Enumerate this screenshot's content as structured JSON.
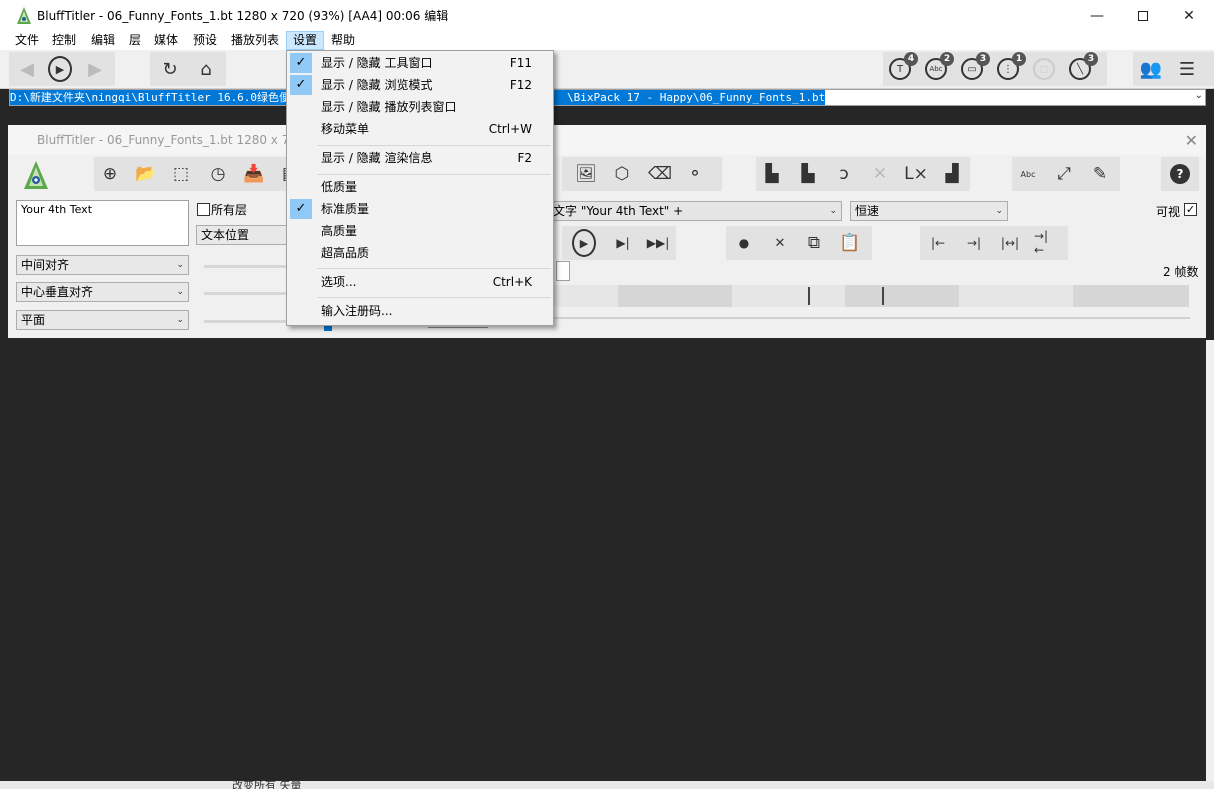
{
  "window": {
    "title": "BluffTitler - 06_Funny_Fonts_1.bt 1280 x 720 (93%) [AA4] 00:06 编辑",
    "minimize_icon": "minimize-icon",
    "maximize_icon": "maximize-icon",
    "close_icon": "close-icon"
  },
  "menubar": {
    "items": [
      "文件",
      "控制",
      "编辑",
      "层",
      "媒体",
      "预设",
      "播放列表",
      "设置",
      "帮助"
    ],
    "active": "设置"
  },
  "toolbar": {
    "badges": [
      "4",
      "2",
      "3",
      "1",
      "3"
    ],
    "abc_label": "Abc"
  },
  "path": {
    "text": "D:\\新建文件夹\\ningqi\\BluffTitler 16.6.0绿色便携版\\Media\\Shows\\BixPack 17 - Happy\\06_Funny_Fonts_1.bt",
    "visible_start": "D:\\新建文件夹\\ningqi\\BluffTitler 16.6.0绿色便携",
    "visible_end": "\\BixPack 17 - Happy\\06_Funny_Fonts_1.bt"
  },
  "child": {
    "title": "BluffTitler - 06_Funny_Fonts_1.bt 1280 x 720",
    "text_value": "Your 4th Text",
    "all_layers_label": "所有层",
    "text_position": "文本位置",
    "align_h": "中间对齐",
    "align_v": "中心垂直对齐",
    "plane": "平面",
    "layer_select": "文字 \"Your 4th Text\" +",
    "speed_select": "恒速",
    "visible_label": "可视",
    "frames_label": "2 帧数",
    "abc_label": "Abc",
    "help_label": "?"
  },
  "dropdown": {
    "items": [
      {
        "label": "显示 / 隐藏  工具窗口",
        "shortcut": "F11",
        "checked": true
      },
      {
        "label": "显示 / 隐藏  浏览模式",
        "shortcut": "F12",
        "checked": true
      },
      {
        "label": "显示 / 隐藏  播放列表窗口",
        "shortcut": "",
        "checked": false
      },
      {
        "label": "移动菜单",
        "shortcut": "Ctrl+W",
        "checked": false
      },
      {
        "label": "显示 / 隐藏  渲染信息",
        "shortcut": "F2",
        "checked": false
      },
      {
        "label": "低质量",
        "shortcut": "",
        "checked": false
      },
      {
        "label": "标准质量",
        "shortcut": "",
        "checked": true
      },
      {
        "label": "高质量",
        "shortcut": "",
        "checked": false
      },
      {
        "label": "超高品质",
        "shortcut": "",
        "checked": false
      },
      {
        "label": "选项...",
        "shortcut": "Ctrl+K",
        "checked": false
      },
      {
        "label": "输入注册码...",
        "shortcut": "",
        "checked": false
      }
    ],
    "check_glyph": "✓"
  },
  "background_fragments": {
    "bottom_text": "改变所有 矢量"
  },
  "colors": {
    "selection": "#0078d7",
    "menu_active": "#cce8ff",
    "check_bg": "#90c8f6",
    "viewport": "#262626"
  }
}
